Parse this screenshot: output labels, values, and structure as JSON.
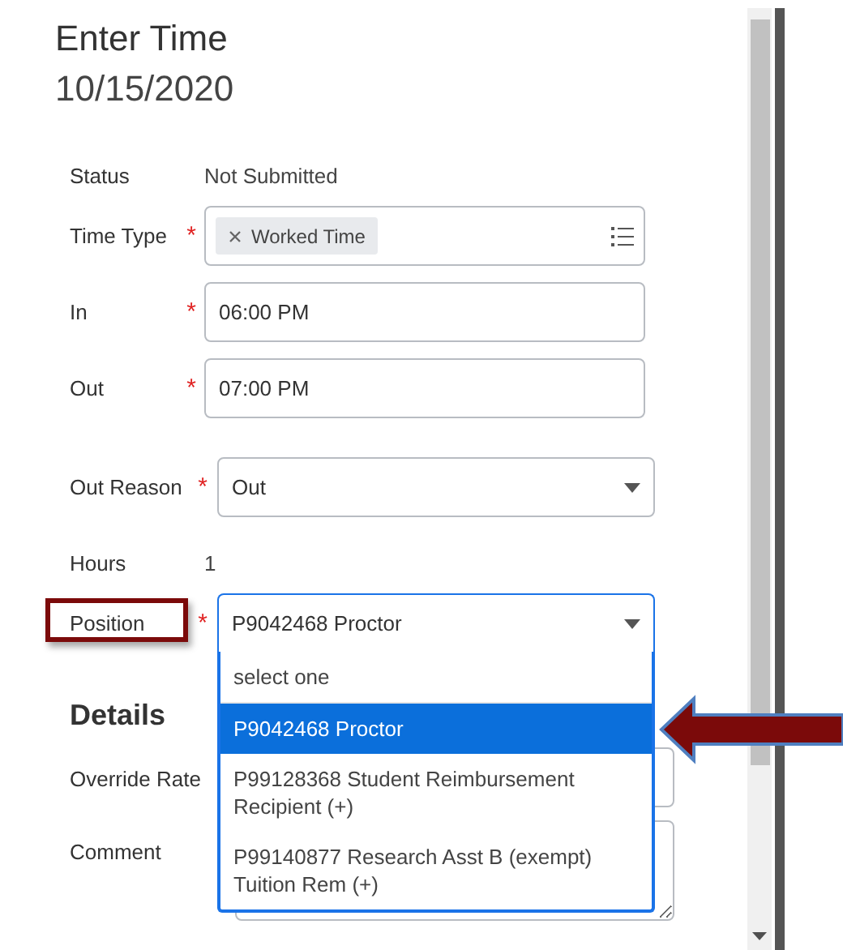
{
  "title": "Enter Time",
  "date": "10/15/2020",
  "fields": [
    {
      "label": "Status",
      "kind": "static",
      "value": "Not Submitted"
    },
    {
      "label": "Time Type",
      "kind": "tokens",
      "required_mark": "*",
      "tokens": [
        "Worked Time"
      ]
    },
    {
      "label": "In",
      "kind": "input",
      "required_mark": "*",
      "value": "06:00 PM"
    },
    {
      "label": "Out",
      "kind": "input",
      "required_mark": "*",
      "value": "07:00 PM"
    },
    {
      "label": "Out Reason",
      "kind": "select",
      "required_mark": "*",
      "value": "Out",
      "expanded": false,
      "highlighted": false
    },
    {
      "label": "Hours",
      "kind": "static",
      "value": "1"
    },
    {
      "label": "Position",
      "kind": "select",
      "required_mark": "*",
      "value": "P9042468 Proctor",
      "expanded": true,
      "highlighted": true,
      "options": [
        {
          "label": "select one",
          "selected": false
        },
        {
          "label": "P9042468 Proctor",
          "selected": true
        },
        {
          "label": "P99128368 Student Reimbursement Recipient (+)",
          "selected": false
        },
        {
          "label": "P99140877 Research Asst B (exempt) Tuition Rem (+)",
          "selected": false
        }
      ]
    }
  ],
  "details": {
    "heading": "Details",
    "fields": [
      {
        "label": "Override Rate",
        "kind": "input"
      },
      {
        "label": "Comment",
        "kind": "textarea"
      }
    ]
  }
}
